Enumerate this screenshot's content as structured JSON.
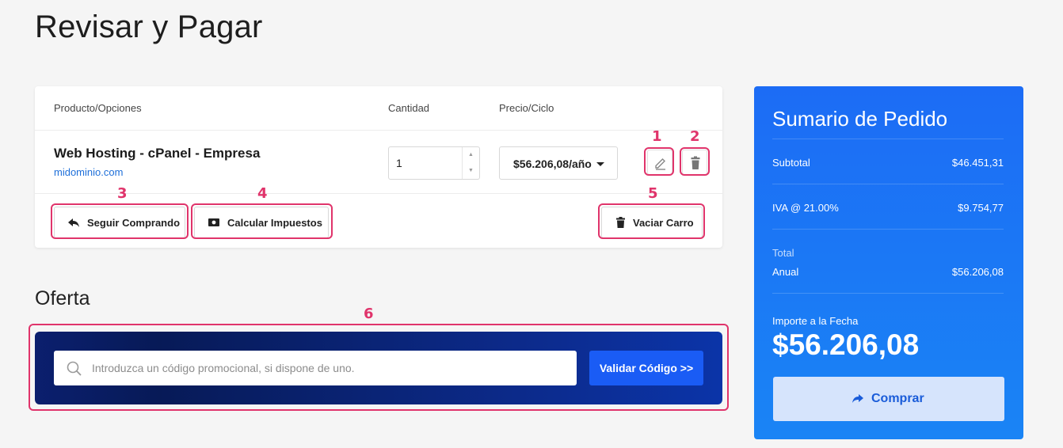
{
  "page": {
    "title": "Revisar y Pagar"
  },
  "cart": {
    "headers": {
      "product": "Producto/Opciones",
      "quantity": "Cantidad",
      "price": "Precio/Ciclo"
    },
    "item": {
      "name": "Web Hosting - cPanel - Empresa",
      "domain": "midominio.com",
      "quantity": "1",
      "price": "$56.206,08/año"
    },
    "buttons": {
      "continue": "Seguir Comprando",
      "taxes": "Calcular Impuestos",
      "empty": "Vaciar Carro"
    }
  },
  "annotations": [
    "1",
    "2",
    "3",
    "4",
    "5",
    "6"
  ],
  "offer": {
    "title": "Oferta",
    "placeholder": "Introduzca un código promocional, si dispone de uno.",
    "button": "Validar Código >>"
  },
  "summary": {
    "title": "Sumario de Pedido",
    "subtotal_label": "Subtotal",
    "subtotal_value": "$46.451,31",
    "tax_label": "IVA @ 21.00%",
    "tax_value": "$9.754,77",
    "total_label": "Total",
    "cycle_label": "Anual",
    "cycle_value": "$56.206,08",
    "due_label": "Importe a la Fecha",
    "due_value": "$56.206,08",
    "checkout": "Comprar"
  },
  "colors": {
    "accent": "#1a5cf5",
    "highlight": "#e0346b",
    "summary_bg": "#1c6cf5",
    "promo_bg": "#0b1f6e"
  }
}
